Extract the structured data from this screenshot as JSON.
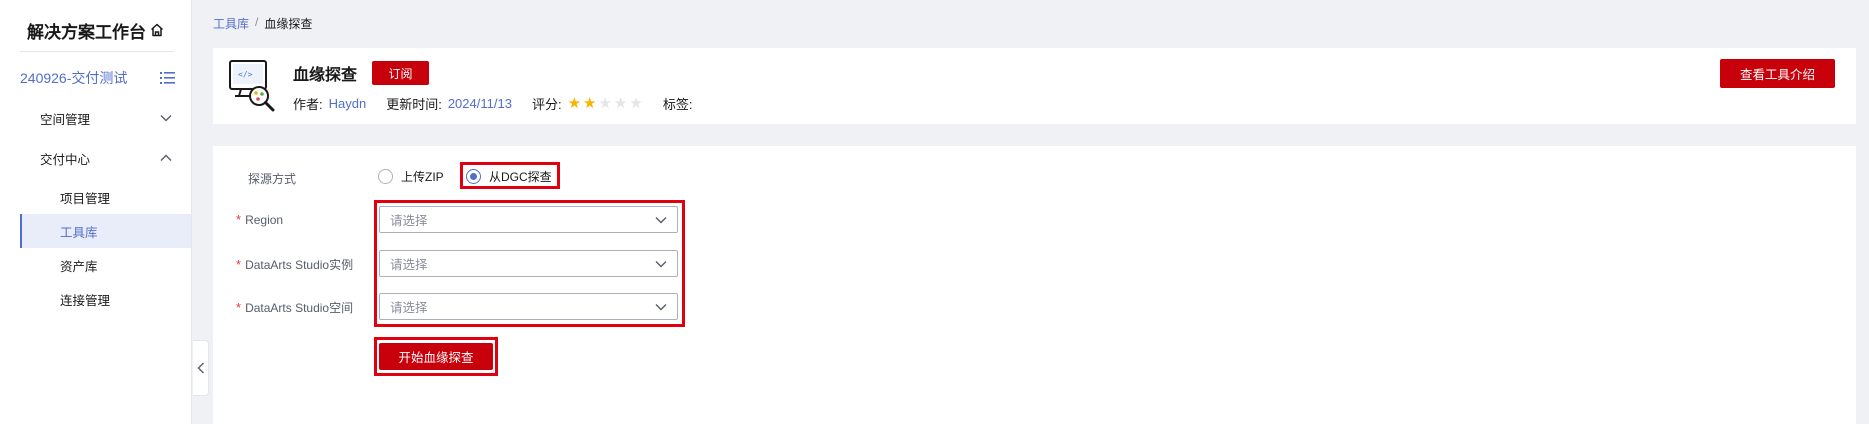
{
  "sidebar": {
    "brand": "解决方案工作台",
    "workspace": "240926-交付测试",
    "groups": [
      {
        "label": "空间管理",
        "expanded": false
      },
      {
        "label": "交付中心",
        "expanded": true
      }
    ],
    "items": [
      {
        "label": "项目管理",
        "active": false
      },
      {
        "label": "工具库",
        "active": true
      },
      {
        "label": "资产库",
        "active": false
      },
      {
        "label": "连接管理",
        "active": false
      }
    ]
  },
  "breadcrumb": {
    "parent": "工具库",
    "separator": "/",
    "current": "血缘探查"
  },
  "tool": {
    "title": "血缘探查",
    "subscribe_label": "订阅",
    "author_label": "作者:",
    "author": "Haydn",
    "updated_label": "更新时间:",
    "updated": "2024/11/13",
    "rating_label": "评分:",
    "rating": 2,
    "rating_max": 5,
    "tags_label": "标签:",
    "intro_button": "查看工具介绍"
  },
  "form": {
    "source_label": "探源方式",
    "source_options": [
      {
        "label": "上传ZIP",
        "checked": false
      },
      {
        "label": "从DGC探查",
        "checked": true
      }
    ],
    "fields": [
      {
        "label": "Region",
        "required": true,
        "placeholder": "请选择"
      },
      {
        "label": "DataArts Studio实例",
        "required": true,
        "placeholder": "请选择"
      },
      {
        "label": "DataArts Studio空间",
        "required": true,
        "placeholder": "请选择"
      }
    ],
    "submit_label": "开始血缘探查"
  },
  "colors": {
    "brand_red": "#c7000b",
    "link_blue": "#526ecc",
    "highlight_red": "#e0000f",
    "star_gold": "#f5b400"
  }
}
